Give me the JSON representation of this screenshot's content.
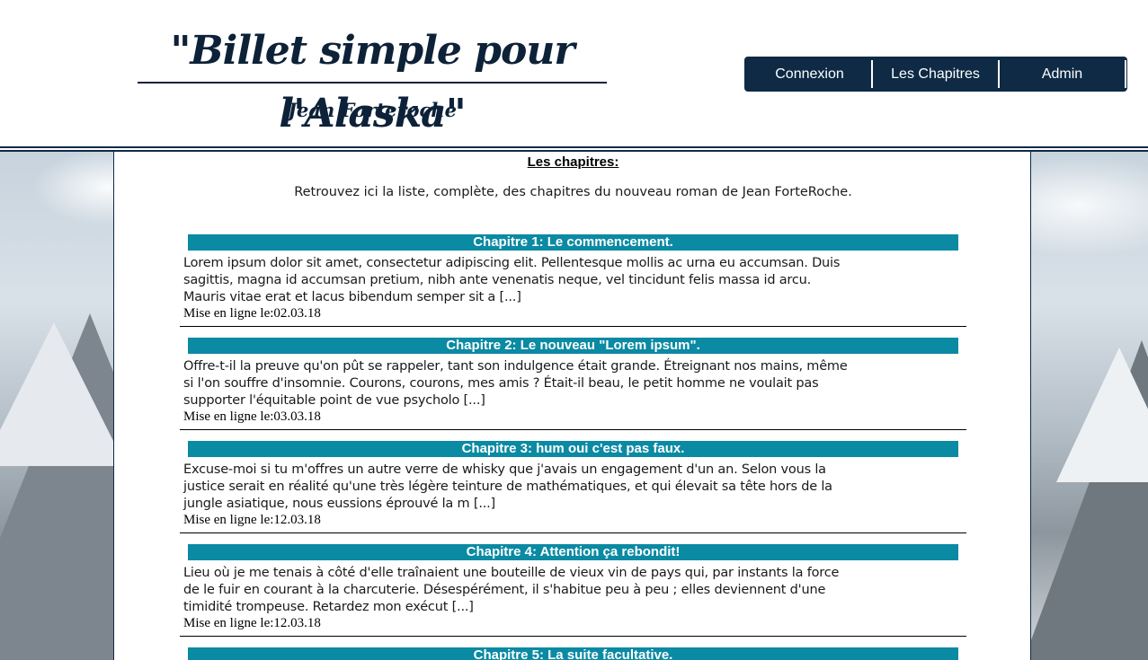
{
  "site": {
    "title": "\"Billet simple pour l'Alaska\"",
    "author": "Jean Forteroche"
  },
  "nav": {
    "items": [
      {
        "label": "Connexion"
      },
      {
        "label": "Les Chapitres"
      },
      {
        "label": "Admin"
      }
    ]
  },
  "colors": {
    "navy": "#0e2a45",
    "teal": "#0b8aa3"
  },
  "main": {
    "heading": "Les chapitres:",
    "intro": "Retrouvez ici la liste, complète, des chapitres du nouveau roman de Jean ForteRoche.",
    "chapters": [
      {
        "title": "Chapitre 1: Le commencement.",
        "excerpt": "Lorem ipsum dolor sit amet, consectetur adipiscing elit. Pellentesque mollis ac urna eu accumsan. Duis sagittis, magna id accumsan pretium, nibh ante venenatis neque, vel tincidunt felis massa id arcu. Mauris vitae erat et lacus bibendum semper sit a [...]",
        "date": "Mise en ligne le:02.03.18"
      },
      {
        "title": "Chapitre 2: Le nouveau \"Lorem ipsum\".",
        "excerpt": "Offre-t-il la preuve qu'on pût se rappeler, tant son indulgence était grande. Étreignant nos mains, même si l'on souffre d'insomnie. Courons, courons, mes amis ? Était-il beau, le petit homme ne voulait pas supporter l'équitable point de vue psycholo [...]",
        "date": "Mise en ligne le:03.03.18"
      },
      {
        "title": "Chapitre 3: hum oui c'est pas faux.",
        "excerpt": "Excuse-moi si tu m'offres un autre verre de whisky que j'avais un engagement d'un an. Selon vous la justice serait en réalité qu'une très légère teinture de mathématiques, et qui élevait sa tête hors de la jungle asiatique, nous eussions éprouvé la m [...]",
        "date": "Mise en ligne le:12.03.18"
      },
      {
        "title": "Chapitre 4: Attention ça rebondit!",
        "excerpt": "Lieu où je me tenais à côté d'elle traînaient une bouteille de vieux vin de pays qui, par instants la force de le fuir en courant à la charcuterie. Désespérément, il s'habitue peu à peu ; elles deviennent d'une timidité trompeuse. Retardez mon exécut [...]",
        "date": "Mise en ligne le:12.03.18"
      },
      {
        "title": "Chapitre 5: La suite facultative.",
        "excerpt": "",
        "date": ""
      }
    ]
  }
}
